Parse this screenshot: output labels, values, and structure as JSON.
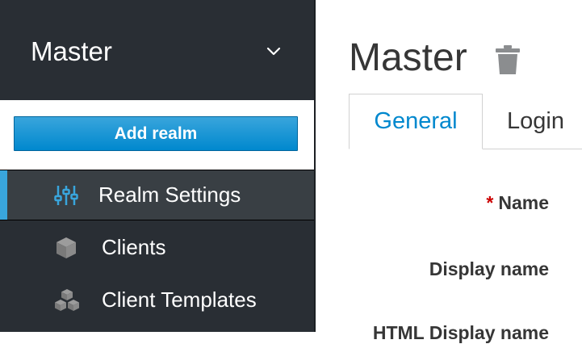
{
  "sidebar": {
    "realm_name": "Master",
    "add_realm_label": "Add realm",
    "items": [
      {
        "label": "Realm Settings",
        "icon": "sliders-icon",
        "active": true
      },
      {
        "label": "Clients",
        "icon": "cube-icon",
        "active": false
      },
      {
        "label": "Client Templates",
        "icon": "cubes-icon",
        "active": false
      }
    ]
  },
  "main": {
    "title": "Master",
    "tabs": [
      {
        "label": "General",
        "active": true
      },
      {
        "label": "Login",
        "active": false
      }
    ],
    "form": {
      "required_marker": "*",
      "name_label": "Name",
      "display_name_label": "Display name",
      "html_display_name_label": "HTML Display name"
    }
  },
  "colors": {
    "sidebar_bg": "#292e34",
    "active_item_bg": "#393f44",
    "accent": "#39a5dc",
    "button_blue": "#0088ce",
    "tab_active_text": "#0088ce",
    "required": "#cc0000"
  }
}
